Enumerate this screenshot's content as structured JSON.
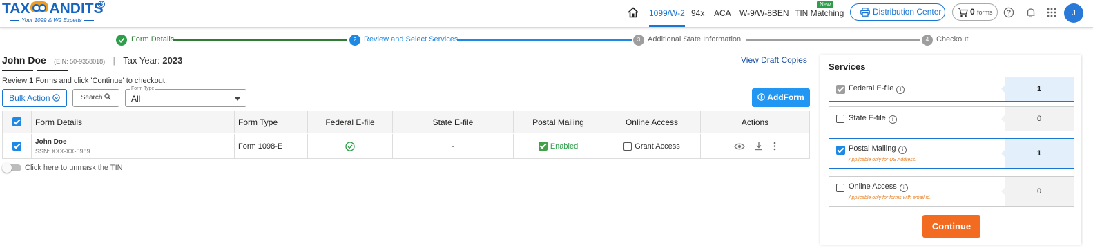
{
  "brand": {
    "logo_left": "TAX",
    "logo_right": "ANDITS",
    "trademark": "R",
    "tagline": "Your 1099 & W2 Experts"
  },
  "topnav": {
    "items": [
      {
        "label": "1099/W-2",
        "active": true
      },
      {
        "label": "94x"
      },
      {
        "label": "ACA"
      },
      {
        "label": "W-9/W-8BEN"
      },
      {
        "label": "TIN Matching",
        "badge": "New"
      }
    ],
    "distribution_center": "Distribution Center",
    "cart_count": "0",
    "cart_unit": "forms",
    "avatar_initial": "J"
  },
  "stepper": {
    "steps": [
      {
        "num": "1",
        "label": "Form Details",
        "state": "done"
      },
      {
        "num": "2",
        "label": "Review and Select Services",
        "state": "current"
      },
      {
        "num": "3",
        "label": "Additional State Information",
        "state": "pending"
      },
      {
        "num": "4",
        "label": "Checkout",
        "state": "pending"
      }
    ]
  },
  "payer": {
    "name": "John Doe",
    "ein": "(EIN: 50-9358018)",
    "separator": "|",
    "tax_year_label": "Tax Year:",
    "tax_year": "2023"
  },
  "view_draft": "View Draft Copies",
  "review": {
    "prefix": "Review",
    "count": "1",
    "suffix": "Forms and click 'Continue' to checkout."
  },
  "toolbar": {
    "bulk_action": "Bulk Action",
    "search": "Search",
    "form_type_label": "Form Type",
    "form_type_value": "All",
    "add_form": "AddForm"
  },
  "table": {
    "headers": [
      "Form Details",
      "Form Type",
      "Federal E-file",
      "State E-file",
      "Postal Mailing",
      "Online Access",
      "Actions"
    ],
    "rows": [
      {
        "name": "John Doe",
        "ssn": "SSN: XXX-XX-5989",
        "form_type": "Form 1098-E",
        "state_efile": "-",
        "postal_mailing": "Enabled",
        "online_access": "Grant Access"
      }
    ]
  },
  "unmask_label": "Click here to unmask the TIN",
  "services": {
    "title": "Services",
    "items": [
      {
        "label": "Federal E-file",
        "count": "1",
        "checked": true,
        "locked": true,
        "note": ""
      },
      {
        "label": "State E-file",
        "count": "0",
        "checked": false,
        "note": ""
      },
      {
        "label": "Postal Mailing",
        "count": "1",
        "checked": true,
        "note": "Applicable only for US Address."
      },
      {
        "label": "Online Access",
        "count": "0",
        "checked": false,
        "note": "Applicable only for forms with email id."
      }
    ],
    "continue": "Continue"
  },
  "colors": {
    "brand_blue": "#1565c0",
    "accent_blue": "#1976d2",
    "success_green": "#2e9e4a",
    "continue_orange": "#f26b21"
  }
}
